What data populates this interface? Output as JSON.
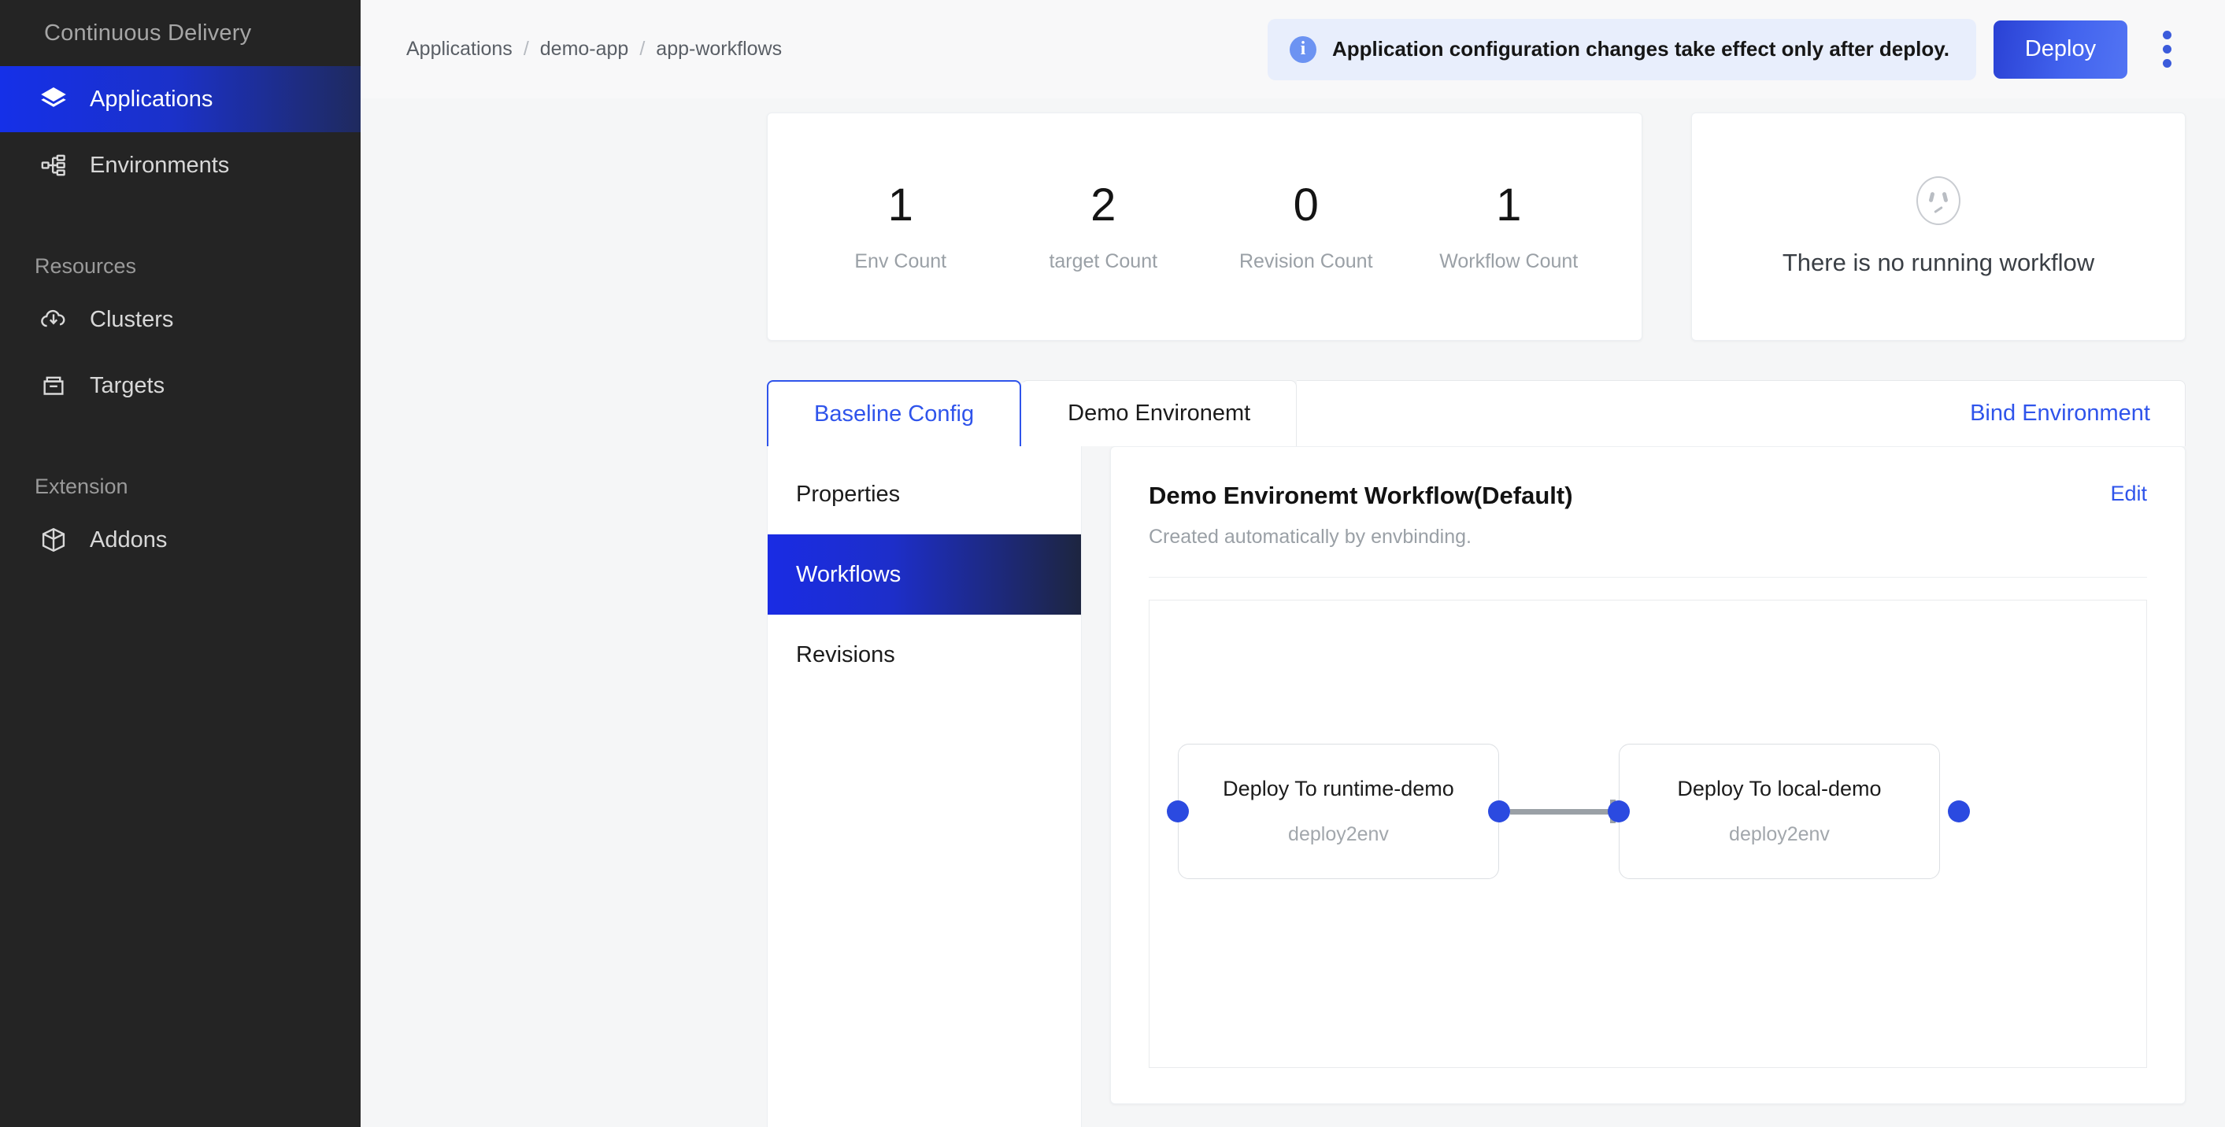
{
  "sidebar": {
    "brand": "Continuous Delivery",
    "items": [
      {
        "label": "Applications",
        "icon": "layers-icon",
        "active": true
      },
      {
        "label": "Environments",
        "icon": "sitemap-icon",
        "active": false
      }
    ],
    "groups": [
      {
        "title": "Resources",
        "items": [
          {
            "label": "Clusters",
            "icon": "cloud-download-icon"
          },
          {
            "label": "Targets",
            "icon": "inbox-icon"
          }
        ]
      },
      {
        "title": "Extension",
        "items": [
          {
            "label": "Addons",
            "icon": "box-icon"
          }
        ]
      }
    ]
  },
  "topbar": {
    "breadcrumb": [
      "Applications",
      "demo-app",
      "app-workflows"
    ],
    "breadcrumb_separator": "/",
    "banner": {
      "icon": "info-circle-icon",
      "text": "Application configuration changes take effect only after deploy."
    },
    "deploy_label": "Deploy",
    "more_menu": "kebab-menu-icon"
  },
  "stats": [
    {
      "value": "1",
      "label": "Env Count"
    },
    {
      "value": "2",
      "label": "target Count"
    },
    {
      "value": "0",
      "label": "Revision Count"
    },
    {
      "value": "1",
      "label": "Workflow Count"
    }
  ],
  "running_workflow": {
    "icon": "sad-face-icon",
    "message": "There is no running workflow"
  },
  "tabs": [
    {
      "label": "Baseline Config",
      "active": true
    },
    {
      "label": "Demo Environemt",
      "active": false
    }
  ],
  "bind_environment_label": "Bind Environment",
  "submenu": [
    {
      "label": "Properties",
      "active": false
    },
    {
      "label": "Workflows",
      "active": true
    },
    {
      "label": "Revisions",
      "active": false
    }
  ],
  "workflow": {
    "title": "Demo Environemt Workflow(Default)",
    "subtitle": "Created automatically by envbinding.",
    "edit_label": "Edit",
    "nodes": [
      {
        "title": "Deploy To runtime-demo",
        "subtitle": "deploy2env"
      },
      {
        "title": "Deploy To local-demo",
        "subtitle": "deploy2env"
      }
    ]
  },
  "colors": {
    "accent_blue": "#2f54eb",
    "deploy_gradient_start": "#2a41d4",
    "deploy_gradient_end": "#5274f3",
    "sidebar_bg": "#242424",
    "active_nav_gradient_start": "#1530e8",
    "active_nav_gradient_end": "#1f2a5e",
    "node_port": "#2b4ae0",
    "banner_bg": "#e8eefc",
    "page_bg": "#f5f6f7"
  }
}
